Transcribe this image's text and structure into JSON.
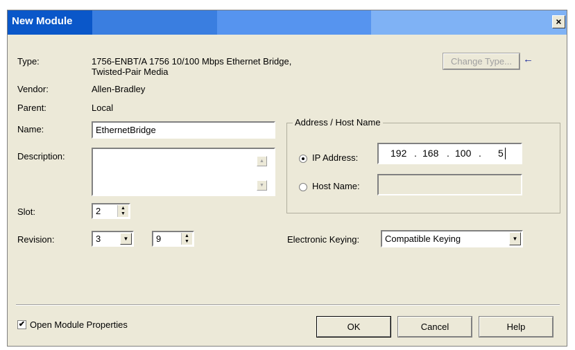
{
  "window": {
    "title": "New Module",
    "close_glyph": "×",
    "titlebar_colors": [
      "#0a57c9",
      "#3a7ee0",
      "#5694ef",
      "#7fb2f5"
    ]
  },
  "module": {
    "type_label": "Type:",
    "type_value_line1": "1756-ENBT/A 1756 10/100 Mbps Ethernet Bridge,",
    "type_value_line2": "Twisted-Pair Media",
    "vendor_label": "Vendor:",
    "vendor_value": "Allen-Bradley",
    "parent_label": "Parent:",
    "parent_value": "Local",
    "name_label": "Name:",
    "name_value": "EthernetBridge",
    "description_label": "Description:",
    "description_value": "",
    "slot_label": "Slot:",
    "slot_value": "2",
    "revision_label": "Revision:",
    "revision_major": "3",
    "revision_minor": "9"
  },
  "change_type": {
    "label": "Change Type...",
    "arrow_icon": "arrow-left-icon",
    "arrow_glyph": "←"
  },
  "address": {
    "group_label": "Address / Host Name",
    "ip_label": "IP Address:",
    "ip_octets": [
      "192",
      "168",
      "100",
      "5"
    ],
    "ip_selected": true,
    "host_label": "Host Name:",
    "host_value": ""
  },
  "keying": {
    "label": "Electronic Keying:",
    "value": "Compatible Keying"
  },
  "footer": {
    "open_props_label": "Open Module Properties",
    "open_props_checked": true,
    "check_glyph": "✔",
    "ok_label": "OK",
    "cancel_label": "Cancel",
    "help_label": "Help"
  },
  "glyphs": {
    "up": "▲",
    "down": "▼"
  }
}
